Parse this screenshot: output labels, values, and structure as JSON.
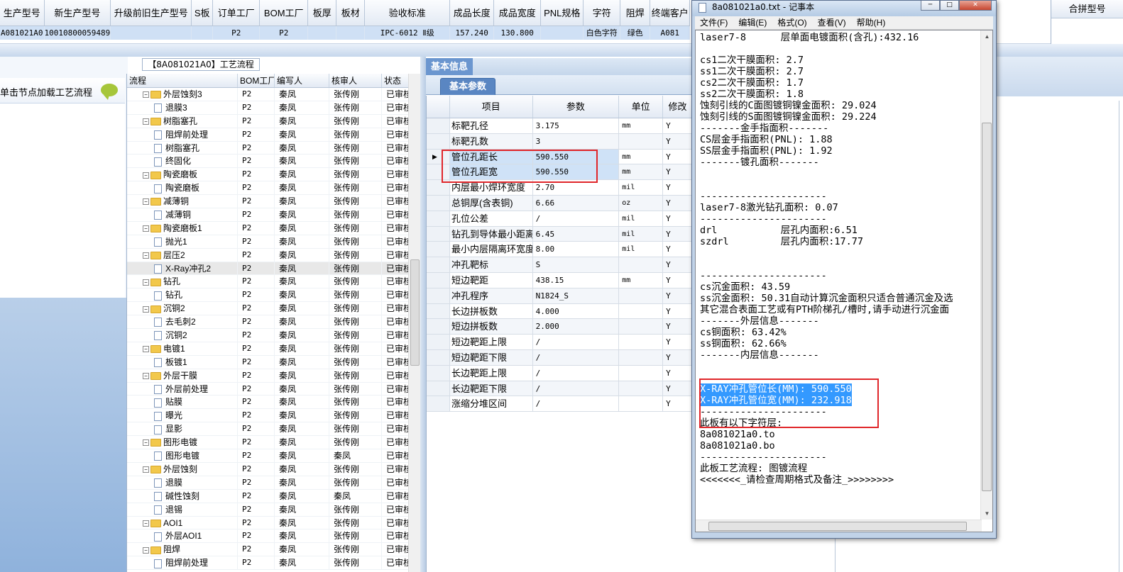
{
  "top_grid": {
    "headers": [
      "生产型号",
      "新生产型号",
      "升级前旧生产型号",
      "S板",
      "订单工厂",
      "BOM工厂",
      "板厚",
      "板材",
      "验收标准",
      "成品长度",
      "成品宽度",
      "PNL规格",
      "字符",
      "阻焊",
      "终端客户"
    ],
    "row": [
      "A081021A0",
      "10010800059489",
      "",
      "",
      "P2",
      "P2",
      "",
      "",
      "IPC-6012 Ⅱ级",
      "157.240",
      "130.800",
      "",
      "白色字符",
      "绿色",
      "A081"
    ],
    "right_header": "合拼型号"
  },
  "tree": {
    "title": "【8A081021A0】工艺流程",
    "hint": "单击节点加载工艺流程",
    "columns": [
      "流程",
      "BOM工厂",
      "编写人",
      "核审人",
      "状态"
    ],
    "rows": [
      {
        "level": 1,
        "type": "folder",
        "name": "外层蚀刻3",
        "bom": "P2",
        "writer": "秦凤",
        "reviewer": "张传刚",
        "status": "已审核"
      },
      {
        "level": 2,
        "type": "doc",
        "name": "退膜3",
        "bom": "P2",
        "writer": "秦凤",
        "reviewer": "张传刚",
        "status": "已审核"
      },
      {
        "level": 1,
        "type": "folder",
        "name": "树脂塞孔",
        "bom": "P2",
        "writer": "秦凤",
        "reviewer": "张传刚",
        "status": "已审核"
      },
      {
        "level": 2,
        "type": "doc",
        "name": "阻焊前处理",
        "bom": "P2",
        "writer": "秦凤",
        "reviewer": "张传刚",
        "status": "已审核"
      },
      {
        "level": 2,
        "type": "doc",
        "name": "树脂塞孔",
        "bom": "P2",
        "writer": "秦凤",
        "reviewer": "张传刚",
        "status": "已审核"
      },
      {
        "level": 2,
        "type": "doc",
        "name": "终固化",
        "bom": "P2",
        "writer": "秦凤",
        "reviewer": "张传刚",
        "status": "已审核"
      },
      {
        "level": 1,
        "type": "folder",
        "name": "陶瓷磨板",
        "bom": "P2",
        "writer": "秦凤",
        "reviewer": "张传刚",
        "status": "已审核"
      },
      {
        "level": 2,
        "type": "doc",
        "name": "陶瓷磨板",
        "bom": "P2",
        "writer": "秦凤",
        "reviewer": "张传刚",
        "status": "已审核"
      },
      {
        "level": 1,
        "type": "folder",
        "name": "减薄铜",
        "bom": "P2",
        "writer": "秦凤",
        "reviewer": "张传刚",
        "status": "已审核"
      },
      {
        "level": 2,
        "type": "doc",
        "name": "减薄铜",
        "bom": "P2",
        "writer": "秦凤",
        "reviewer": "张传刚",
        "status": "已审核"
      },
      {
        "level": 1,
        "type": "folder",
        "name": "陶瓷磨板1",
        "bom": "P2",
        "writer": "秦凤",
        "reviewer": "张传刚",
        "status": "已审核"
      },
      {
        "level": 2,
        "type": "doc",
        "name": "抛光1",
        "bom": "P2",
        "writer": "秦凤",
        "reviewer": "张传刚",
        "status": "已审核"
      },
      {
        "level": 1,
        "type": "folder",
        "name": "层压2",
        "bom": "P2",
        "writer": "秦凤",
        "reviewer": "张传刚",
        "status": "已审核"
      },
      {
        "level": 2,
        "type": "doc",
        "name": "X-Ray冲孔2",
        "bom": "P2",
        "writer": "秦凤",
        "reviewer": "张传刚",
        "status": "已审核",
        "selected": true
      },
      {
        "level": 1,
        "type": "folder",
        "name": "钻孔",
        "bom": "P2",
        "writer": "秦凤",
        "reviewer": "张传刚",
        "status": "已审核"
      },
      {
        "level": 2,
        "type": "doc",
        "name": "钻孔",
        "bom": "P2",
        "writer": "秦凤",
        "reviewer": "张传刚",
        "status": "已审核"
      },
      {
        "level": 1,
        "type": "folder",
        "name": "沉铜2",
        "bom": "P2",
        "writer": "秦凤",
        "reviewer": "张传刚",
        "status": "已审核"
      },
      {
        "level": 2,
        "type": "doc",
        "name": "去毛刺2",
        "bom": "P2",
        "writer": "秦凤",
        "reviewer": "张传刚",
        "status": "已审核"
      },
      {
        "level": 2,
        "type": "doc",
        "name": "沉铜2",
        "bom": "P2",
        "writer": "秦凤",
        "reviewer": "张传刚",
        "status": "已审核"
      },
      {
        "level": 1,
        "type": "folder",
        "name": "电镀1",
        "bom": "P2",
        "writer": "秦凤",
        "reviewer": "张传刚",
        "status": "已审核"
      },
      {
        "level": 2,
        "type": "doc",
        "name": "板镀1",
        "bom": "P2",
        "writer": "秦凤",
        "reviewer": "张传刚",
        "status": "已审核"
      },
      {
        "level": 1,
        "type": "folder",
        "name": "外层干膜",
        "bom": "P2",
        "writer": "秦凤",
        "reviewer": "张传刚",
        "status": "已审核"
      },
      {
        "level": 2,
        "type": "doc",
        "name": "外层前处理",
        "bom": "P2",
        "writer": "秦凤",
        "reviewer": "张传刚",
        "status": "已审核"
      },
      {
        "level": 2,
        "type": "doc",
        "name": "贴膜",
        "bom": "P2",
        "writer": "秦凤",
        "reviewer": "张传刚",
        "status": "已审核"
      },
      {
        "level": 2,
        "type": "doc",
        "name": "曝光",
        "bom": "P2",
        "writer": "秦凤",
        "reviewer": "张传刚",
        "status": "已审核"
      },
      {
        "level": 2,
        "type": "doc",
        "name": "显影",
        "bom": "P2",
        "writer": "秦凤",
        "reviewer": "张传刚",
        "status": "已审核"
      },
      {
        "level": 1,
        "type": "folder",
        "name": "图形电镀",
        "bom": "P2",
        "writer": "秦凤",
        "reviewer": "张传刚",
        "status": "已审核"
      },
      {
        "level": 2,
        "type": "doc",
        "name": "图形电镀",
        "bom": "P2",
        "writer": "秦凤",
        "reviewer": "秦凤",
        "status": "已审核"
      },
      {
        "level": 1,
        "type": "folder",
        "name": "外层蚀刻",
        "bom": "P2",
        "writer": "秦凤",
        "reviewer": "张传刚",
        "status": "已审核"
      },
      {
        "level": 2,
        "type": "doc",
        "name": "退膜",
        "bom": "P2",
        "writer": "秦凤",
        "reviewer": "张传刚",
        "status": "已审核"
      },
      {
        "level": 2,
        "type": "doc",
        "name": "碱性蚀刻",
        "bom": "P2",
        "writer": "秦凤",
        "reviewer": "秦凤",
        "status": "已审核"
      },
      {
        "level": 2,
        "type": "doc",
        "name": "退锡",
        "bom": "P2",
        "writer": "秦凤",
        "reviewer": "张传刚",
        "status": "已审核"
      },
      {
        "level": 1,
        "type": "folder",
        "name": "AOI1",
        "bom": "P2",
        "writer": "秦凤",
        "reviewer": "张传刚",
        "status": "已审核"
      },
      {
        "level": 2,
        "type": "doc",
        "name": "外层AOI1",
        "bom": "P2",
        "writer": "秦凤",
        "reviewer": "张传刚",
        "status": "已审核"
      },
      {
        "level": 1,
        "type": "folder",
        "name": "阻焊",
        "bom": "P2",
        "writer": "秦凤",
        "reviewer": "张传刚",
        "status": "已审核"
      },
      {
        "level": 2,
        "type": "doc",
        "name": "阻焊前处理",
        "bom": "P2",
        "writer": "秦凤",
        "reviewer": "张传刚",
        "status": "已审核"
      }
    ]
  },
  "base_info": {
    "header": "基本信息",
    "tab": "基本参数",
    "columns": [
      "项目",
      "参数",
      "单位",
      "修改"
    ],
    "rows": [
      {
        "item": "标靶孔径",
        "value": "3.175",
        "unit": "mm",
        "mod": "Y"
      },
      {
        "item": "标靶孔数",
        "value": "3",
        "unit": "",
        "mod": "Y"
      },
      {
        "item": "管位孔距长",
        "value": "590.550",
        "unit": "mm",
        "mod": "Y",
        "highlight": true,
        "current": true
      },
      {
        "item": "管位孔距宽",
        "value": "590.550",
        "unit": "mm",
        "mod": "Y",
        "highlight": true
      },
      {
        "item": "内层最小焊环宽度",
        "value": "2.70",
        "unit": "mil",
        "mod": "Y"
      },
      {
        "item": "总铜厚(含表铜)",
        "value": "6.66",
        "unit": "oz",
        "mod": "Y"
      },
      {
        "item": "孔位公差",
        "value": "/",
        "unit": "mil",
        "mod": "Y"
      },
      {
        "item": "钻孔到导体最小距离",
        "value": "6.45",
        "unit": "mil",
        "mod": "Y"
      },
      {
        "item": "最小内层隔离环宽度",
        "value": "8.00",
        "unit": "mil",
        "mod": "Y"
      },
      {
        "item": "冲孔靶标",
        "value": "S",
        "unit": "",
        "mod": "Y"
      },
      {
        "item": "短边靶距",
        "value": "438.15",
        "unit": "mm",
        "mod": "Y"
      },
      {
        "item": "冲孔程序",
        "value": "N1824_S",
        "unit": "",
        "mod": "Y"
      },
      {
        "item": "长边拼板数",
        "value": "4.000",
        "unit": "",
        "mod": "Y"
      },
      {
        "item": "短边拼板数",
        "value": "2.000",
        "unit": "",
        "mod": "Y"
      },
      {
        "item": "短边靶距上限",
        "value": "/",
        "unit": "",
        "mod": "Y"
      },
      {
        "item": "短边靶距下限",
        "value": "/",
        "unit": "",
        "mod": "Y"
      },
      {
        "item": "长边靶距上限",
        "value": "/",
        "unit": "",
        "mod": "Y"
      },
      {
        "item": "长边靶距下限",
        "value": "/",
        "unit": "",
        "mod": "Y"
      },
      {
        "item": "涨缩分堆区间",
        "value": "/",
        "unit": "",
        "mod": "Y"
      }
    ]
  },
  "notepad": {
    "title": "8a081021a0.txt - 记事本",
    "menu": [
      "文件(F)",
      "编辑(E)",
      "格式(O)",
      "查看(V)",
      "帮助(H)"
    ],
    "lines": [
      {
        "t": "laser7-8      层单面电镀面积(含孔):432.16"
      },
      {
        "t": ""
      },
      {
        "t": "cs1二次干膜面积: 2.7"
      },
      {
        "t": "ss1二次干膜面积: 2.7"
      },
      {
        "t": "cs2二次干膜面积: 1.7"
      },
      {
        "t": "ss2二次干膜面积: 1.8"
      },
      {
        "t": "蚀刻引线的C面图镀铜镍金面积: 29.024"
      },
      {
        "t": "蚀刻引线的S面图镀铜镍金面积: 29.224"
      },
      {
        "t": "-------金手指面积-------"
      },
      {
        "t": "CS层金手指面积(PNL): 1.88"
      },
      {
        "t": "SS层金手指面积(PNL): 1.92"
      },
      {
        "t": "-------镀孔面积-------"
      },
      {
        "t": ""
      },
      {
        "t": ""
      },
      {
        "t": "----------------------"
      },
      {
        "t": "laser7-8激光钻孔面积: 0.07"
      },
      {
        "t": "----------------------"
      },
      {
        "t": "drl           层孔内面积:6.51"
      },
      {
        "t": "szdrl         层孔内面积:17.77"
      },
      {
        "t": ""
      },
      {
        "t": ""
      },
      {
        "t": "----------------------"
      },
      {
        "t": "cs沉金面积: 43.59"
      },
      {
        "t": "ss沉金面积: 50.31自动计算沉金面积只适合普通沉金及选"
      },
      {
        "t": "其它混合表面工艺或有PTH阶梯孔/槽时,请手动进行沉金面"
      },
      {
        "t": "-------外层信息-------"
      },
      {
        "t": "cs铜面积: 63.42%"
      },
      {
        "t": "ss铜面积: 62.66%"
      },
      {
        "t": "-------内层信息-------"
      },
      {
        "t": ""
      },
      {
        "t": ""
      },
      {
        "t": "X-RAY冲孔管位长(MM): 590.550",
        "hl": true
      },
      {
        "t": "X-RAY冲孔管位宽(MM): 232.918",
        "hl": true
      },
      {
        "t": "----------------------"
      },
      {
        "t": "此板有以下字符层:"
      },
      {
        "t": "8a081021a0.to"
      },
      {
        "t": "8a081021a0.bo"
      },
      {
        "t": "----------------------"
      },
      {
        "t": "此板工艺流程: 图镀流程"
      },
      {
        "t": "<<<<<<<_请检查周期格式及备注_>>>>>>>>"
      }
    ]
  }
}
